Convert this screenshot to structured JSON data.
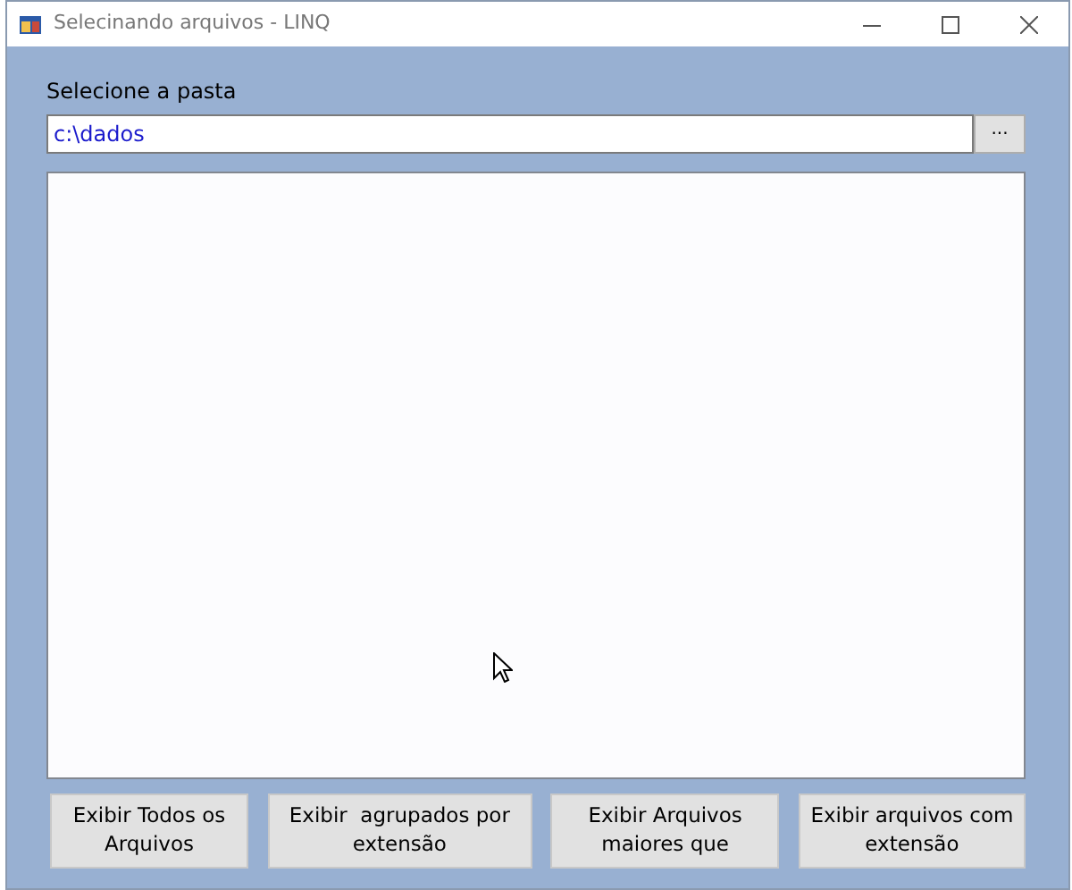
{
  "window": {
    "title": "Selecinando arquivos - LINQ"
  },
  "folder_label": "Selecione a pasta",
  "folder_field": {
    "value": "c:\\dados"
  },
  "browse_button": "...",
  "buttons": [
    "Exibir Todos os\nArquivos",
    "Exibir  agrupados por\nextensão",
    "Exibir Arquivos\nmaiores que",
    "Exibir arquivos com\nextensão"
  ]
}
